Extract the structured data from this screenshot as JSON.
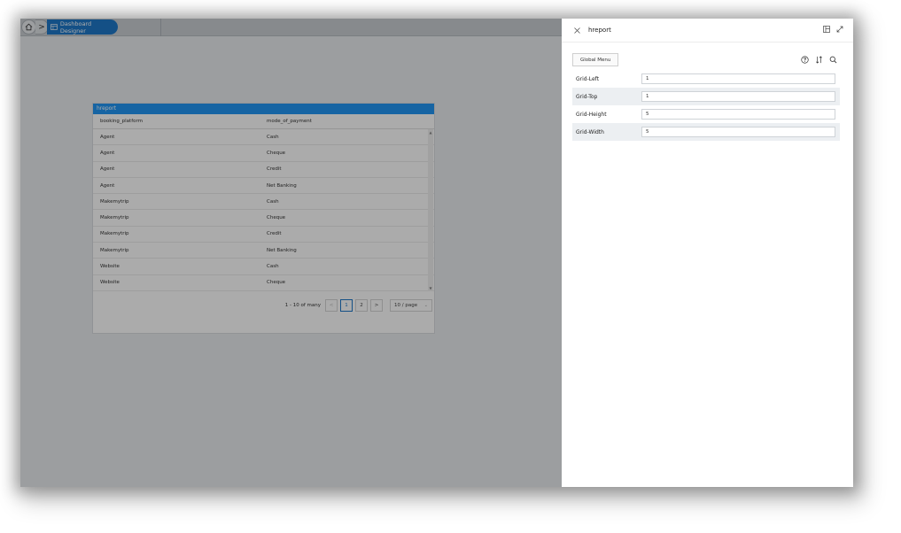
{
  "breadcrumb": {
    "active_label": "Dashboard Designer"
  },
  "report": {
    "title": "hreport",
    "columns": [
      "booking_platform",
      "mode_of_payment"
    ],
    "rows": [
      [
        "Agent",
        "Cash"
      ],
      [
        "Agent",
        "Cheque"
      ],
      [
        "Agent",
        "Credit"
      ],
      [
        "Agent",
        "Net Banking"
      ],
      [
        "Makemytrip",
        "Cash"
      ],
      [
        "Makemytrip",
        "Cheque"
      ],
      [
        "Makemytrip",
        "Credit"
      ],
      [
        "Makemytrip",
        "Net Banking"
      ],
      [
        "Website",
        "Cash"
      ],
      [
        "Website",
        "Cheque"
      ]
    ],
    "pagination": {
      "range_text": "1 - 10 of many",
      "prev": "<",
      "pages": [
        "1",
        "2"
      ],
      "current_page": "1",
      "next": ">",
      "page_size": "10 / page"
    }
  },
  "panel": {
    "title": "hreport",
    "global_menu_label": "Global Menu",
    "properties": [
      {
        "label": "Grid-Left",
        "value": "1"
      },
      {
        "label": "Grid-Top",
        "value": "1"
      },
      {
        "label": "Grid-Height",
        "value": "5"
      },
      {
        "label": "Grid-Width",
        "value": "5"
      }
    ]
  },
  "colors": {
    "accent": "#1f78c8",
    "report_header": "#2196f3"
  }
}
